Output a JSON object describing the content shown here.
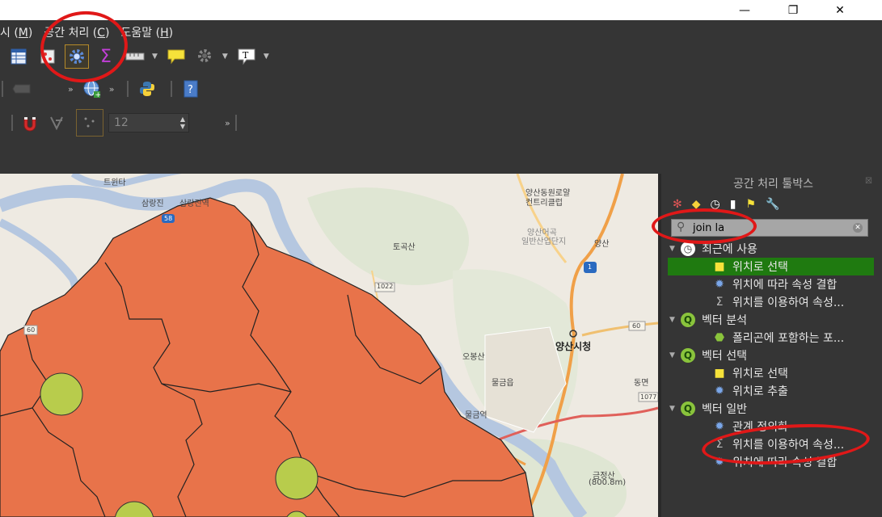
{
  "menubar": {
    "items": [
      {
        "text": "시 (",
        "key": "M",
        "tail": ")"
      },
      {
        "text": "공간 처리 (",
        "key": "C",
        "tail": ")"
      },
      {
        "text": "도움말 (",
        "key": "H",
        "tail": ")"
      }
    ]
  },
  "toolbar": {
    "spin_value": "12",
    "processing_toolbox_icon": "gear-icon",
    "sum_icon": "sigma-icon"
  },
  "map": {
    "labels": [
      "트윈타",
      "삼랑진",
      "삼랑진역",
      "토곡산",
      "1022",
      "양산동원로얄",
      "컨트리클럽",
      "양산어곡",
      "일반산업단지",
      "양산",
      "오봉산",
      "양산시청",
      "물금읍",
      "물금역",
      "동면",
      "1077",
      "금정산",
      "(800.8m)",
      "58",
      "60",
      "60",
      "1"
    ]
  },
  "toolbox": {
    "title": "공간 처리 툴박스",
    "search_value": "join la",
    "tree": [
      {
        "type": "group",
        "icon": "clock-icon",
        "label": "최근에 사용"
      },
      {
        "type": "leaf",
        "icon": "select-location-icon",
        "label": "위치로 선택",
        "selected": true
      },
      {
        "type": "leaf",
        "icon": "gear-icon",
        "label": "위치에 따라 속성 결합"
      },
      {
        "type": "leaf",
        "icon": "sigma-icon",
        "label": "위치를 이용하여 속성..."
      },
      {
        "type": "group",
        "icon": "qgis-icon",
        "label": "벡터 분석"
      },
      {
        "type": "leaf",
        "icon": "polygon-count-icon",
        "label": "폴리곤에 포함하는 포..."
      },
      {
        "type": "group",
        "icon": "qgis-icon",
        "label": "벡터 선택"
      },
      {
        "type": "leaf",
        "icon": "select-location-icon",
        "label": "위치로 선택"
      },
      {
        "type": "leaf",
        "icon": "gear-icon",
        "label": "위치로 추출"
      },
      {
        "type": "group",
        "icon": "qgis-icon",
        "label": "벡터 일반"
      },
      {
        "type": "leaf",
        "icon": "gear-icon",
        "label": "관계 정의화"
      },
      {
        "type": "leaf",
        "icon": "sigma-icon",
        "label": "위치를 이용하여 속성..."
      },
      {
        "type": "leaf",
        "icon": "gear-icon",
        "label": "위치에 따라 속성 결합"
      }
    ]
  },
  "colors": {
    "polygon_fill": "#e8734a",
    "point_fill": "#b8cc4c",
    "selection": "#1f7a10",
    "annotation": "#e01818"
  }
}
